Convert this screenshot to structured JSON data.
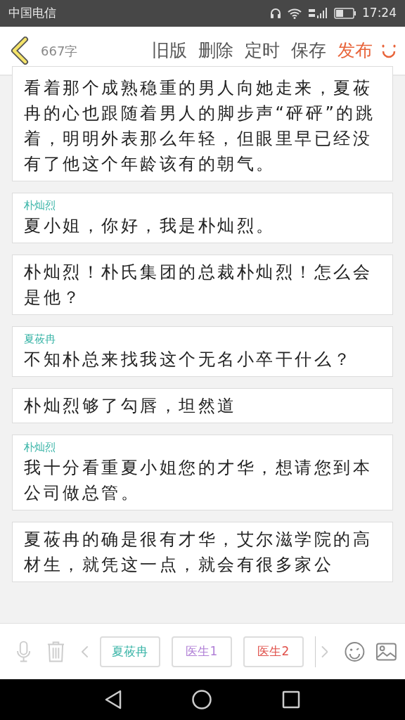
{
  "status_bar": {
    "carrier": "中国电信",
    "time": "17:24"
  },
  "header": {
    "word_count": "667字",
    "actions": [
      "旧版",
      "删除",
      "定时",
      "保存"
    ],
    "publish": "发布"
  },
  "cards": [
    {
      "kind": "narration",
      "text": "看着那个成熟稳重的男人向她走来，夏莜冉的心也跟随着男人的脚步声“砰砰”的跳着，明明外表那么年轻，但眼里早已经没有了他这个年龄该有的朝气。"
    },
    {
      "kind": "dialogue",
      "speaker": "朴灿烈",
      "text": "夏小姐，你好，我是朴灿烈。"
    },
    {
      "kind": "narration",
      "text": "朴灿烈！朴氏集团的总裁朴灿烈！怎么会是他？"
    },
    {
      "kind": "dialogue",
      "speaker": "夏莜冉",
      "text": "不知朴总来找我这个无名小卒干什么？"
    },
    {
      "kind": "narration",
      "text": "朴灿烈够了勾唇，坦然道"
    },
    {
      "kind": "dialogue",
      "speaker": "朴灿烈",
      "text": "我十分看重夏小姐您的才华，想请您到本公司做总管。"
    },
    {
      "kind": "narration",
      "text": "夏莜冉的确是很有才华，艾尔滋学院的高材生，就凭这一点，就会有很多家公"
    }
  ],
  "roles": [
    {
      "label": "夏莜冉",
      "color": "#3bb5a8"
    },
    {
      "label": "医生1",
      "color": "#b07fd6"
    },
    {
      "label": "医生2",
      "color": "#e0504a"
    }
  ]
}
